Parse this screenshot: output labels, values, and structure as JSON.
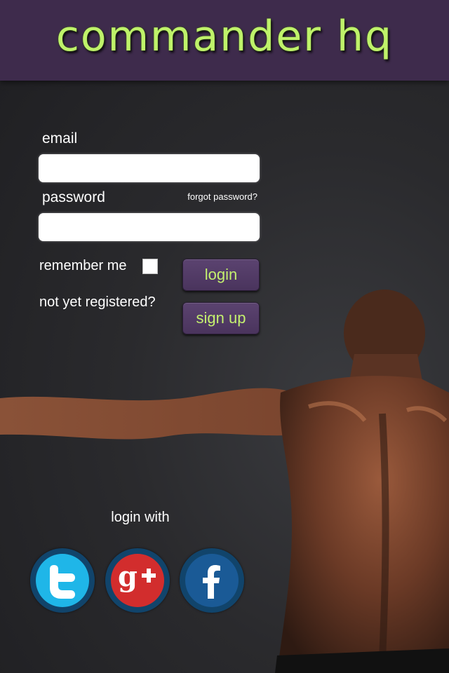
{
  "app": {
    "brand": "commander hq"
  },
  "form": {
    "email_label": "email",
    "email_value": "",
    "email_placeholder": "",
    "password_label": "password",
    "password_value": "",
    "password_placeholder": "",
    "forgot_label": "forgot password?",
    "remember_label": "remember me",
    "remember_checked": false,
    "login_label": "login",
    "not_registered_label": "not yet registered?",
    "signup_label": "sign up"
  },
  "social": {
    "heading": "login with",
    "items": [
      {
        "name": "twitter",
        "icon": "twitter-icon",
        "color": "#1fb6e8"
      },
      {
        "name": "google-plus",
        "icon": "google-plus-icon",
        "color": "#d22d2d"
      },
      {
        "name": "facebook",
        "icon": "facebook-icon",
        "color": "#1a5a96"
      }
    ]
  },
  "colors": {
    "header_bg": "#3e2b4c",
    "brand_text": "#bff26a",
    "button_bg": "#4f3963",
    "button_text": "#c4f06f",
    "background": "#2a2a2d"
  }
}
